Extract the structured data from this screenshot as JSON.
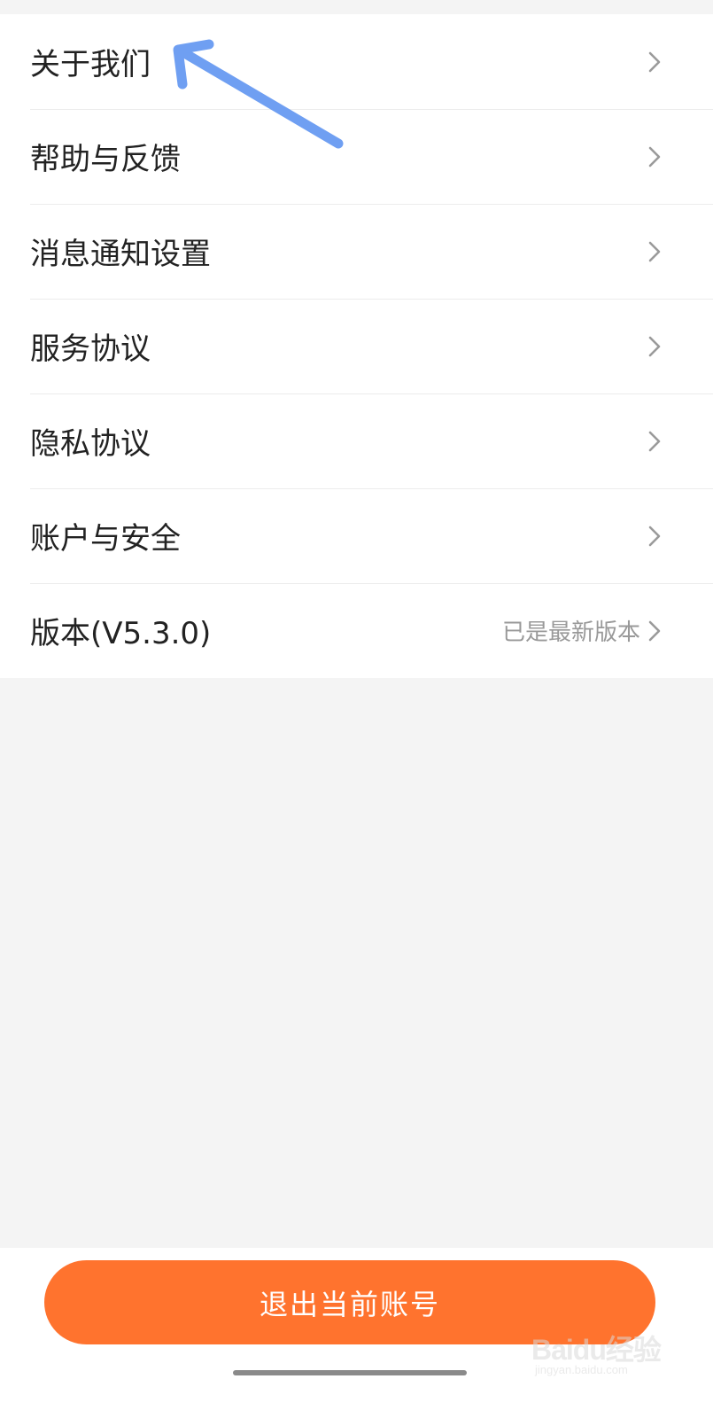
{
  "settings": {
    "items": [
      {
        "label": "关于我们",
        "value": ""
      },
      {
        "label": "帮助与反馈",
        "value": ""
      },
      {
        "label": "消息通知设置",
        "value": ""
      },
      {
        "label": "服务协议",
        "value": ""
      },
      {
        "label": "隐私协议",
        "value": ""
      },
      {
        "label": "账户与安全",
        "value": ""
      },
      {
        "label": "版本(V5.3.0)",
        "value": "已是最新版本"
      }
    ]
  },
  "logout": {
    "label": "退出当前账号"
  },
  "watermark": {
    "brand": "Baidu经验",
    "site": "jingyan.baidu.com"
  },
  "colors": {
    "accent": "#ff732e",
    "annotation": "#6f9ff2"
  },
  "icons": {
    "row_chevron": "chevron-right-icon"
  }
}
